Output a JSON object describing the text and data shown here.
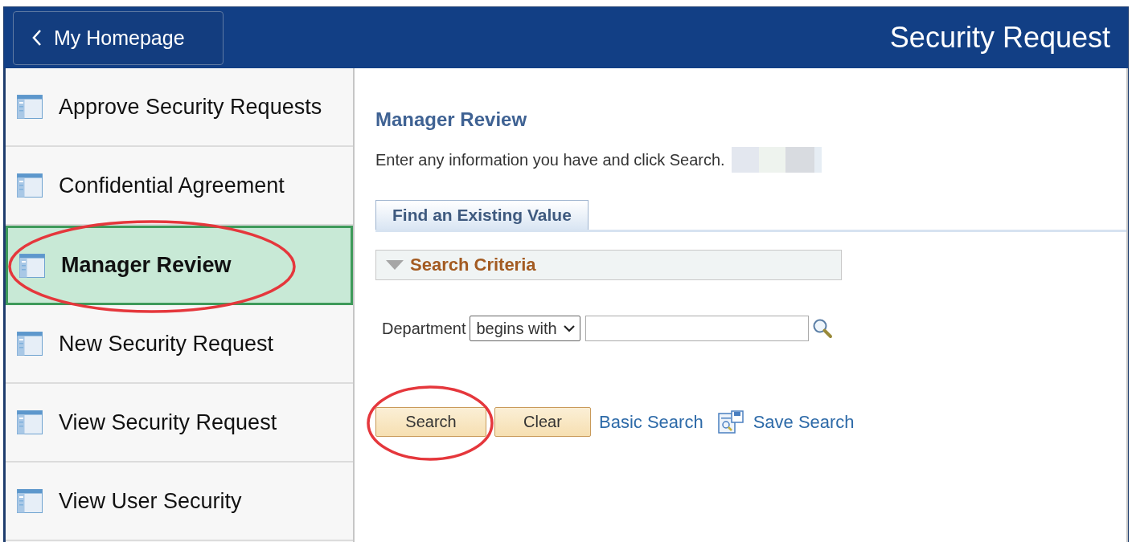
{
  "header": {
    "back_button": "My Homepage",
    "title": "Security Request"
  },
  "sidebar": {
    "items": [
      {
        "label": "Approve Security Requests",
        "selected": false,
        "circled": false
      },
      {
        "label": "Confidential Agreement",
        "selected": false,
        "circled": false
      },
      {
        "label": "Manager Review",
        "selected": true,
        "circled": true
      },
      {
        "label": "New Security Request",
        "selected": false,
        "circled": false
      },
      {
        "label": "View Security Request",
        "selected": false,
        "circled": false
      },
      {
        "label": "View User Security",
        "selected": false,
        "circled": false
      }
    ]
  },
  "content": {
    "title": "Manager Review",
    "instruction": "Enter any information you have and click Search.",
    "redacted": true,
    "tabs": [
      {
        "label": "Find an Existing Value",
        "selected": true
      }
    ],
    "section": {
      "label": "Search Criteria",
      "expanded": true
    },
    "fields": [
      {
        "label": "Department",
        "operator": "begins with"
      }
    ],
    "buttons": [
      {
        "label": "Search",
        "circled": true
      },
      {
        "label": "Clear",
        "circled": false
      }
    ],
    "links": [
      {
        "label": "Basic Search",
        "icon": false
      },
      {
        "label": "Save Search",
        "icon": true
      }
    ]
  }
}
